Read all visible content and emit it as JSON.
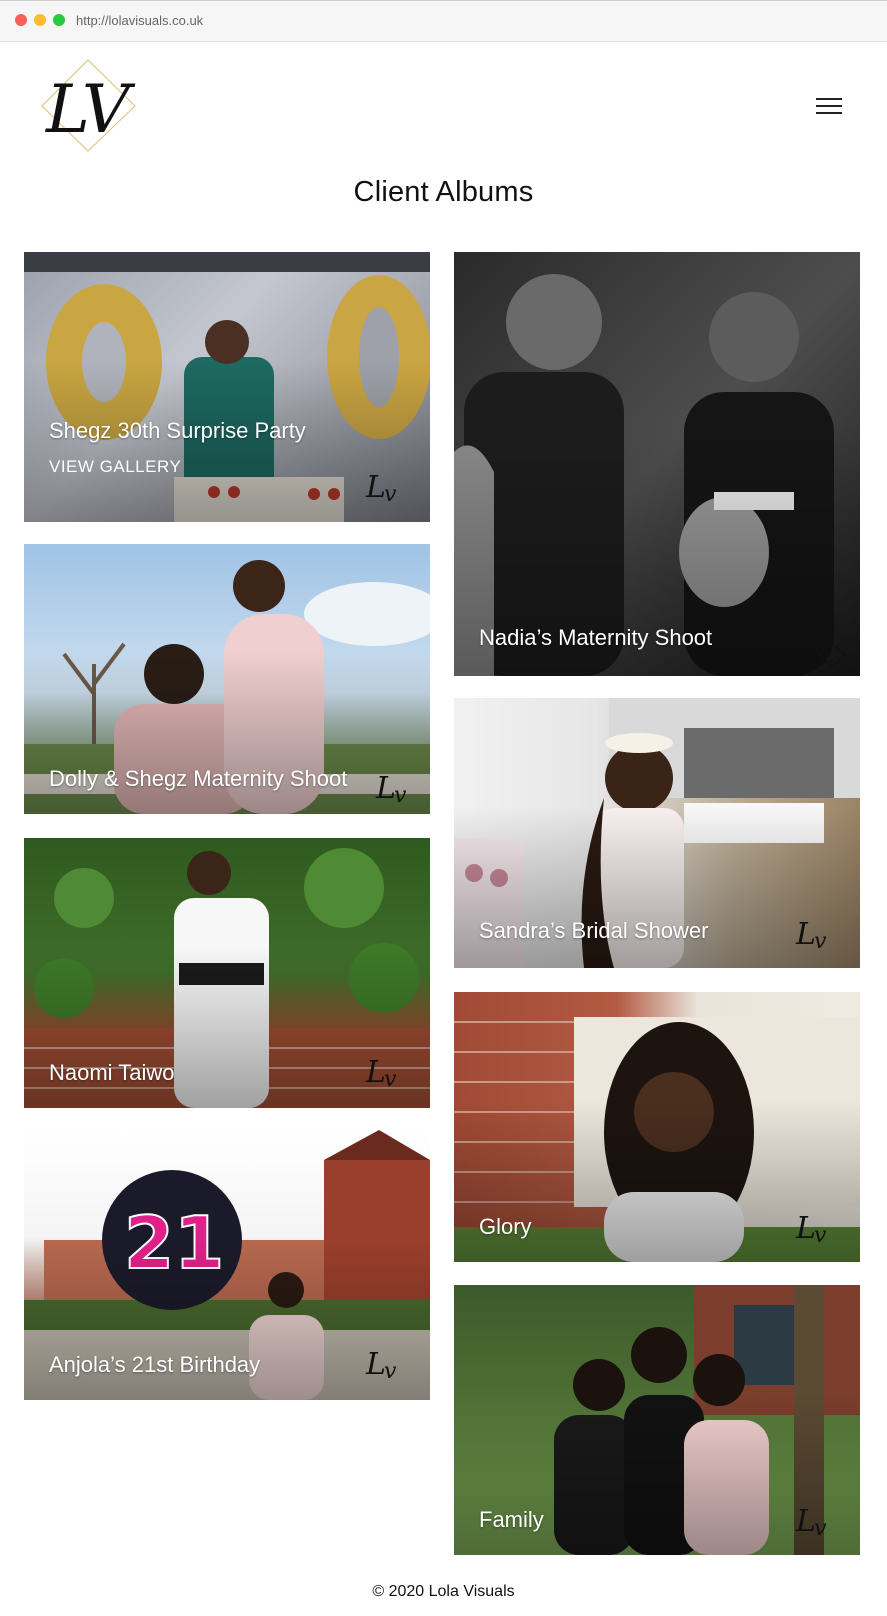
{
  "browser": {
    "url": "http://lolavisuals.co.uk"
  },
  "header": {
    "logo_text": "LV"
  },
  "page": {
    "title": "Client Albums"
  },
  "albums": [
    {
      "title": "Shegz 30th Surprise Party",
      "cta": "VIEW GALLERY"
    },
    {
      "title": "Nadia’s Maternity Shoot"
    },
    {
      "title": "Dolly & Shegz Maternity Shoot"
    },
    {
      "title": "Sandra’s Bridal Shower"
    },
    {
      "title": "Naomi Taiwo"
    },
    {
      "title": "Glory"
    },
    {
      "title": "Anjola’s 21st Birthday"
    },
    {
      "title": "Family"
    }
  ],
  "footer": {
    "copyright": "© 2020 Lola Visuals"
  }
}
